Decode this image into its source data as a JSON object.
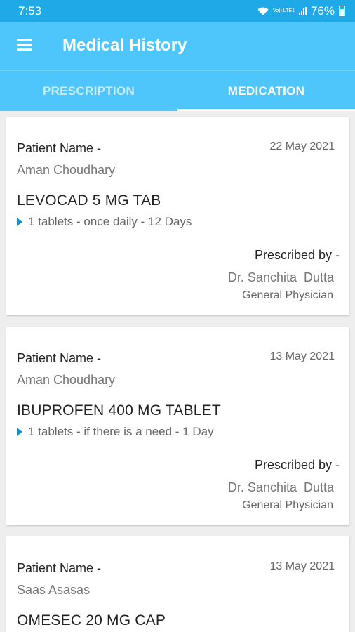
{
  "status_bar": {
    "time": "7:53",
    "network_label": "Vo)) LTE1",
    "battery": "76%"
  },
  "app_bar": {
    "title": "Medical History"
  },
  "tabs": [
    {
      "label": "PRESCRIPTION",
      "active": false
    },
    {
      "label": "MEDICATION",
      "active": true
    }
  ],
  "records": [
    {
      "patient_label": "Patient Name -",
      "date": "22 May 2021",
      "patient_name": "Aman Choudhary",
      "medicine": "LEVOCAD 5 MG TAB",
      "dosage": "1 tablets - once daily - 12 Days",
      "prescribed_label": "Prescribed by -",
      "doctor": "Dr. Sanchita  Dutta",
      "specialty": "General Physician"
    },
    {
      "patient_label": "Patient Name -",
      "date": "13 May 2021",
      "patient_name": "Aman Choudhary",
      "medicine": "IBUPROFEN 400 MG TABLET",
      "dosage": "1 tablets - if there is a need - 1 Day",
      "prescribed_label": "Prescribed by -",
      "doctor": "Dr. Sanchita  Dutta",
      "specialty": "General Physician"
    },
    {
      "patient_label": "Patient Name -",
      "date": "13 May 2021",
      "patient_name": "Saas Asasas",
      "medicine": "OMESEC 20 MG CAP"
    }
  ],
  "colors": {
    "status_bar": "#1fa9e6",
    "app_bar": "#4ec6fb",
    "background": "#eeeeee",
    "dosage_arrow": "#1b8fc7"
  },
  "icons": {
    "menu": "hamburger-menu-icon",
    "wifi": "wifi-icon",
    "signal": "signal-icon",
    "battery": "battery-icon",
    "dosage": "play-arrow-icon"
  }
}
